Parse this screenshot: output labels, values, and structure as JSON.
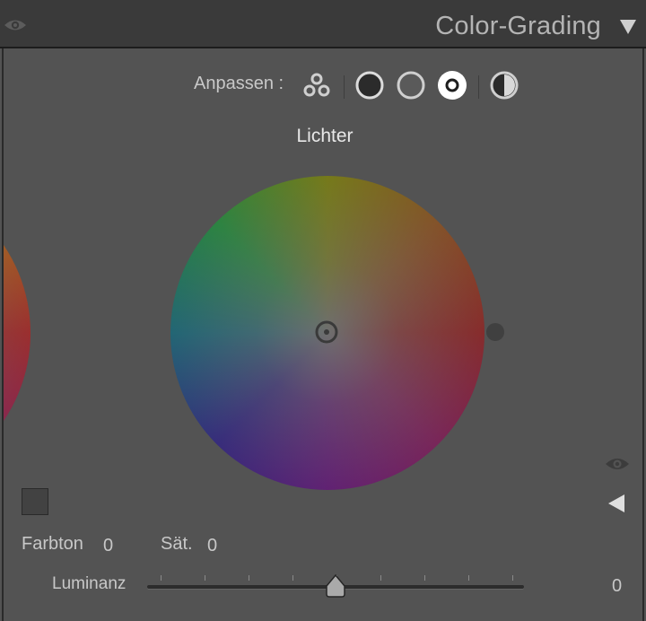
{
  "panel": {
    "title": "Color-Grading",
    "visibility_icon": "eye-icon",
    "collapse_icon": "triangle-down-icon"
  },
  "adjust": {
    "label": "Anpassen :",
    "modes": [
      {
        "name": "3-way",
        "icon": "three-circles-icon"
      },
      {
        "name": "shadows",
        "icon": "filled-circle-icon"
      },
      {
        "name": "midtones",
        "icon": "hollow-circle-icon"
      },
      {
        "name": "highlights",
        "icon": "ring-dot-icon",
        "selected": true
      },
      {
        "name": "global",
        "icon": "half-circle-icon"
      }
    ]
  },
  "wheel": {
    "title": "Lichter",
    "hue": 0,
    "saturation": 0
  },
  "controls": {
    "hue_label": "Farbton",
    "hue_value": "0",
    "sat_label": "Sät.",
    "sat_value": "0",
    "luminance_label": "Luminanz",
    "luminance_value": "0",
    "luminance_min": -100,
    "luminance_max": 100
  },
  "colors": {
    "panel_bg": "#535353",
    "header_bg": "#3a3a3a",
    "selected_mode": "#ffffff"
  }
}
